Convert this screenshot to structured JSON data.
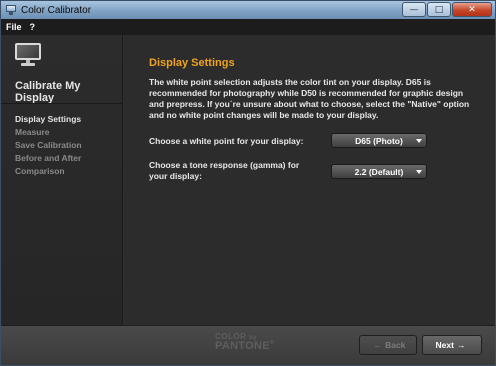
{
  "window": {
    "title": "Color Calibrator",
    "minimize_glyph": "—",
    "maximize_glyph": "□",
    "close_glyph": "✕"
  },
  "menubar": {
    "items": [
      "File",
      "?"
    ]
  },
  "sidebar": {
    "icon": "monitor-icon",
    "title": "Calibrate My Display",
    "steps": [
      {
        "label": "Display Settings",
        "active": true
      },
      {
        "label": "Measure",
        "active": false
      },
      {
        "label": "Save Calibration",
        "active": false
      },
      {
        "label": "Before and After Comparison",
        "active": false
      }
    ]
  },
  "main": {
    "section_title": "Display Settings",
    "description": "The white point selection adjusts the color tint on your display. D65 is recommended for photography while D50 is recommended for graphic design and prepress. If you´re unsure about what to choose, select the \"Native\" option and no white point changes will be made to your display.",
    "white_point": {
      "label": "Choose a white point for your display:",
      "value": "D65 (Photo)"
    },
    "tone_response": {
      "label": "Choose a tone response (gamma) for your display:",
      "value": "2.2 (Default)"
    }
  },
  "footer": {
    "brand_line1": "COLOR",
    "brand_line1_small": "by",
    "brand_line2": "PANTONE",
    "brand_mark": "®",
    "back_label": "Back",
    "back_arrow": "←",
    "next_label": "Next",
    "next_arrow": "→"
  },
  "colors": {
    "accent": "#f0a321",
    "background": "#2c2c2c"
  }
}
